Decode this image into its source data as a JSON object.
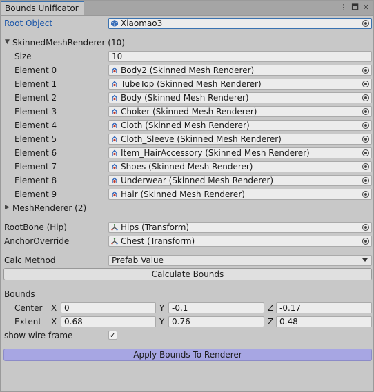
{
  "window": {
    "tab_title": "Bounds Unificator",
    "menu_icon": "kebab-icon",
    "maximize_icon": "maximize-icon",
    "close_icon": "close-icon"
  },
  "root_object": {
    "label": "Root Object",
    "value": "Xiaomao3"
  },
  "skinned": {
    "header": "SkinnedMeshRenderer (10)",
    "size_label": "Size",
    "size_value": "10",
    "elements": [
      {
        "label": "Element 0",
        "value": "Body2 (Skinned Mesh Renderer)"
      },
      {
        "label": "Element 1",
        "value": "TubeTop (Skinned Mesh Renderer)"
      },
      {
        "label": "Element 2",
        "value": "Body (Skinned Mesh Renderer)"
      },
      {
        "label": "Element 3",
        "value": "Choker (Skinned Mesh Renderer)"
      },
      {
        "label": "Element 4",
        "value": "Cloth (Skinned Mesh Renderer)"
      },
      {
        "label": "Element 5",
        "value": "Cloth_Sleeve (Skinned Mesh Renderer)"
      },
      {
        "label": "Element 6",
        "value": "Item_HairAccessory (Skinned Mesh Renderer)"
      },
      {
        "label": "Element 7",
        "value": "Shoes (Skinned Mesh Renderer)"
      },
      {
        "label": "Element 8",
        "value": "Underwear (Skinned Mesh Renderer)"
      },
      {
        "label": "Element 9",
        "value": "Hair (Skinned Mesh Renderer)"
      }
    ]
  },
  "mesh": {
    "header": "MeshRenderer (2)"
  },
  "rootbone": {
    "label": "RootBone (Hip)",
    "value": "Hips (Transform)"
  },
  "anchor": {
    "label": "AnchorOverride",
    "value": "Chest (Transform)"
  },
  "calc": {
    "label": "Calc Method",
    "value": "Prefab Value",
    "button": "Calculate Bounds"
  },
  "bounds": {
    "label": "Bounds",
    "center": {
      "label": "Center",
      "x": "0",
      "y": "-0.1",
      "z": "-0.17"
    },
    "extent": {
      "label": "Extent",
      "x": "0.68",
      "y": "0.76",
      "z": "0.48"
    },
    "axis_x": "X",
    "axis_y": "Y",
    "axis_z": "Z"
  },
  "wire": {
    "label": "show wire frame",
    "checked": "✓"
  },
  "apply": {
    "button": "Apply Bounds To Renderer"
  },
  "colors": {
    "accent_button": "#a7a6e3",
    "tab_highlight": "#3a72b0",
    "label_blue": "#1a55a8"
  }
}
